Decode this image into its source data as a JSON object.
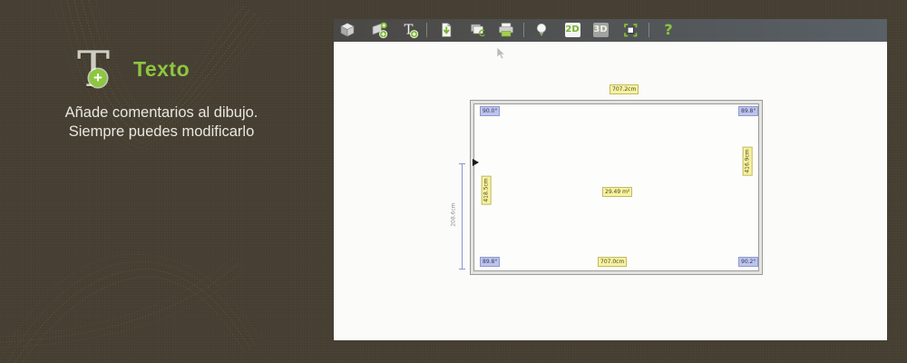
{
  "left_panel": {
    "icon_letter": "T",
    "icon_plus": "+",
    "title": "Texto",
    "description_line1": "Añade comentarios al dibujo.",
    "description_line2": "Siempre puedes modificarlo"
  },
  "toolbar": {
    "view_2d_label": "2D",
    "view_3d_label": "3D",
    "help_label": "?",
    "icons": [
      "view-cube",
      "add-wall",
      "add-text",
      "export-document",
      "export-image",
      "print",
      "light",
      "view-2d",
      "view-3d",
      "fit-screen",
      "help"
    ]
  },
  "floor_plan": {
    "dimensions": {
      "top": "707.2cm",
      "bottom": "707.0cm",
      "left": "418.5cm",
      "right": "416.9cm",
      "external": "208.6cm"
    },
    "area": "29.49 m²",
    "angles": {
      "top_left": "90.0°",
      "top_right": "89.8°",
      "bottom_left": "89.8°",
      "bottom_right": "90.2°"
    }
  },
  "colors": {
    "accent_green": "#8dc63f",
    "background_olive": "#453e31",
    "toolbar_grey": "#4d4f52",
    "dimension_label_yellow": "#f6f2a2",
    "angle_label_blue": "#bdc4ea",
    "canvas_white": "#fbfbf9"
  }
}
